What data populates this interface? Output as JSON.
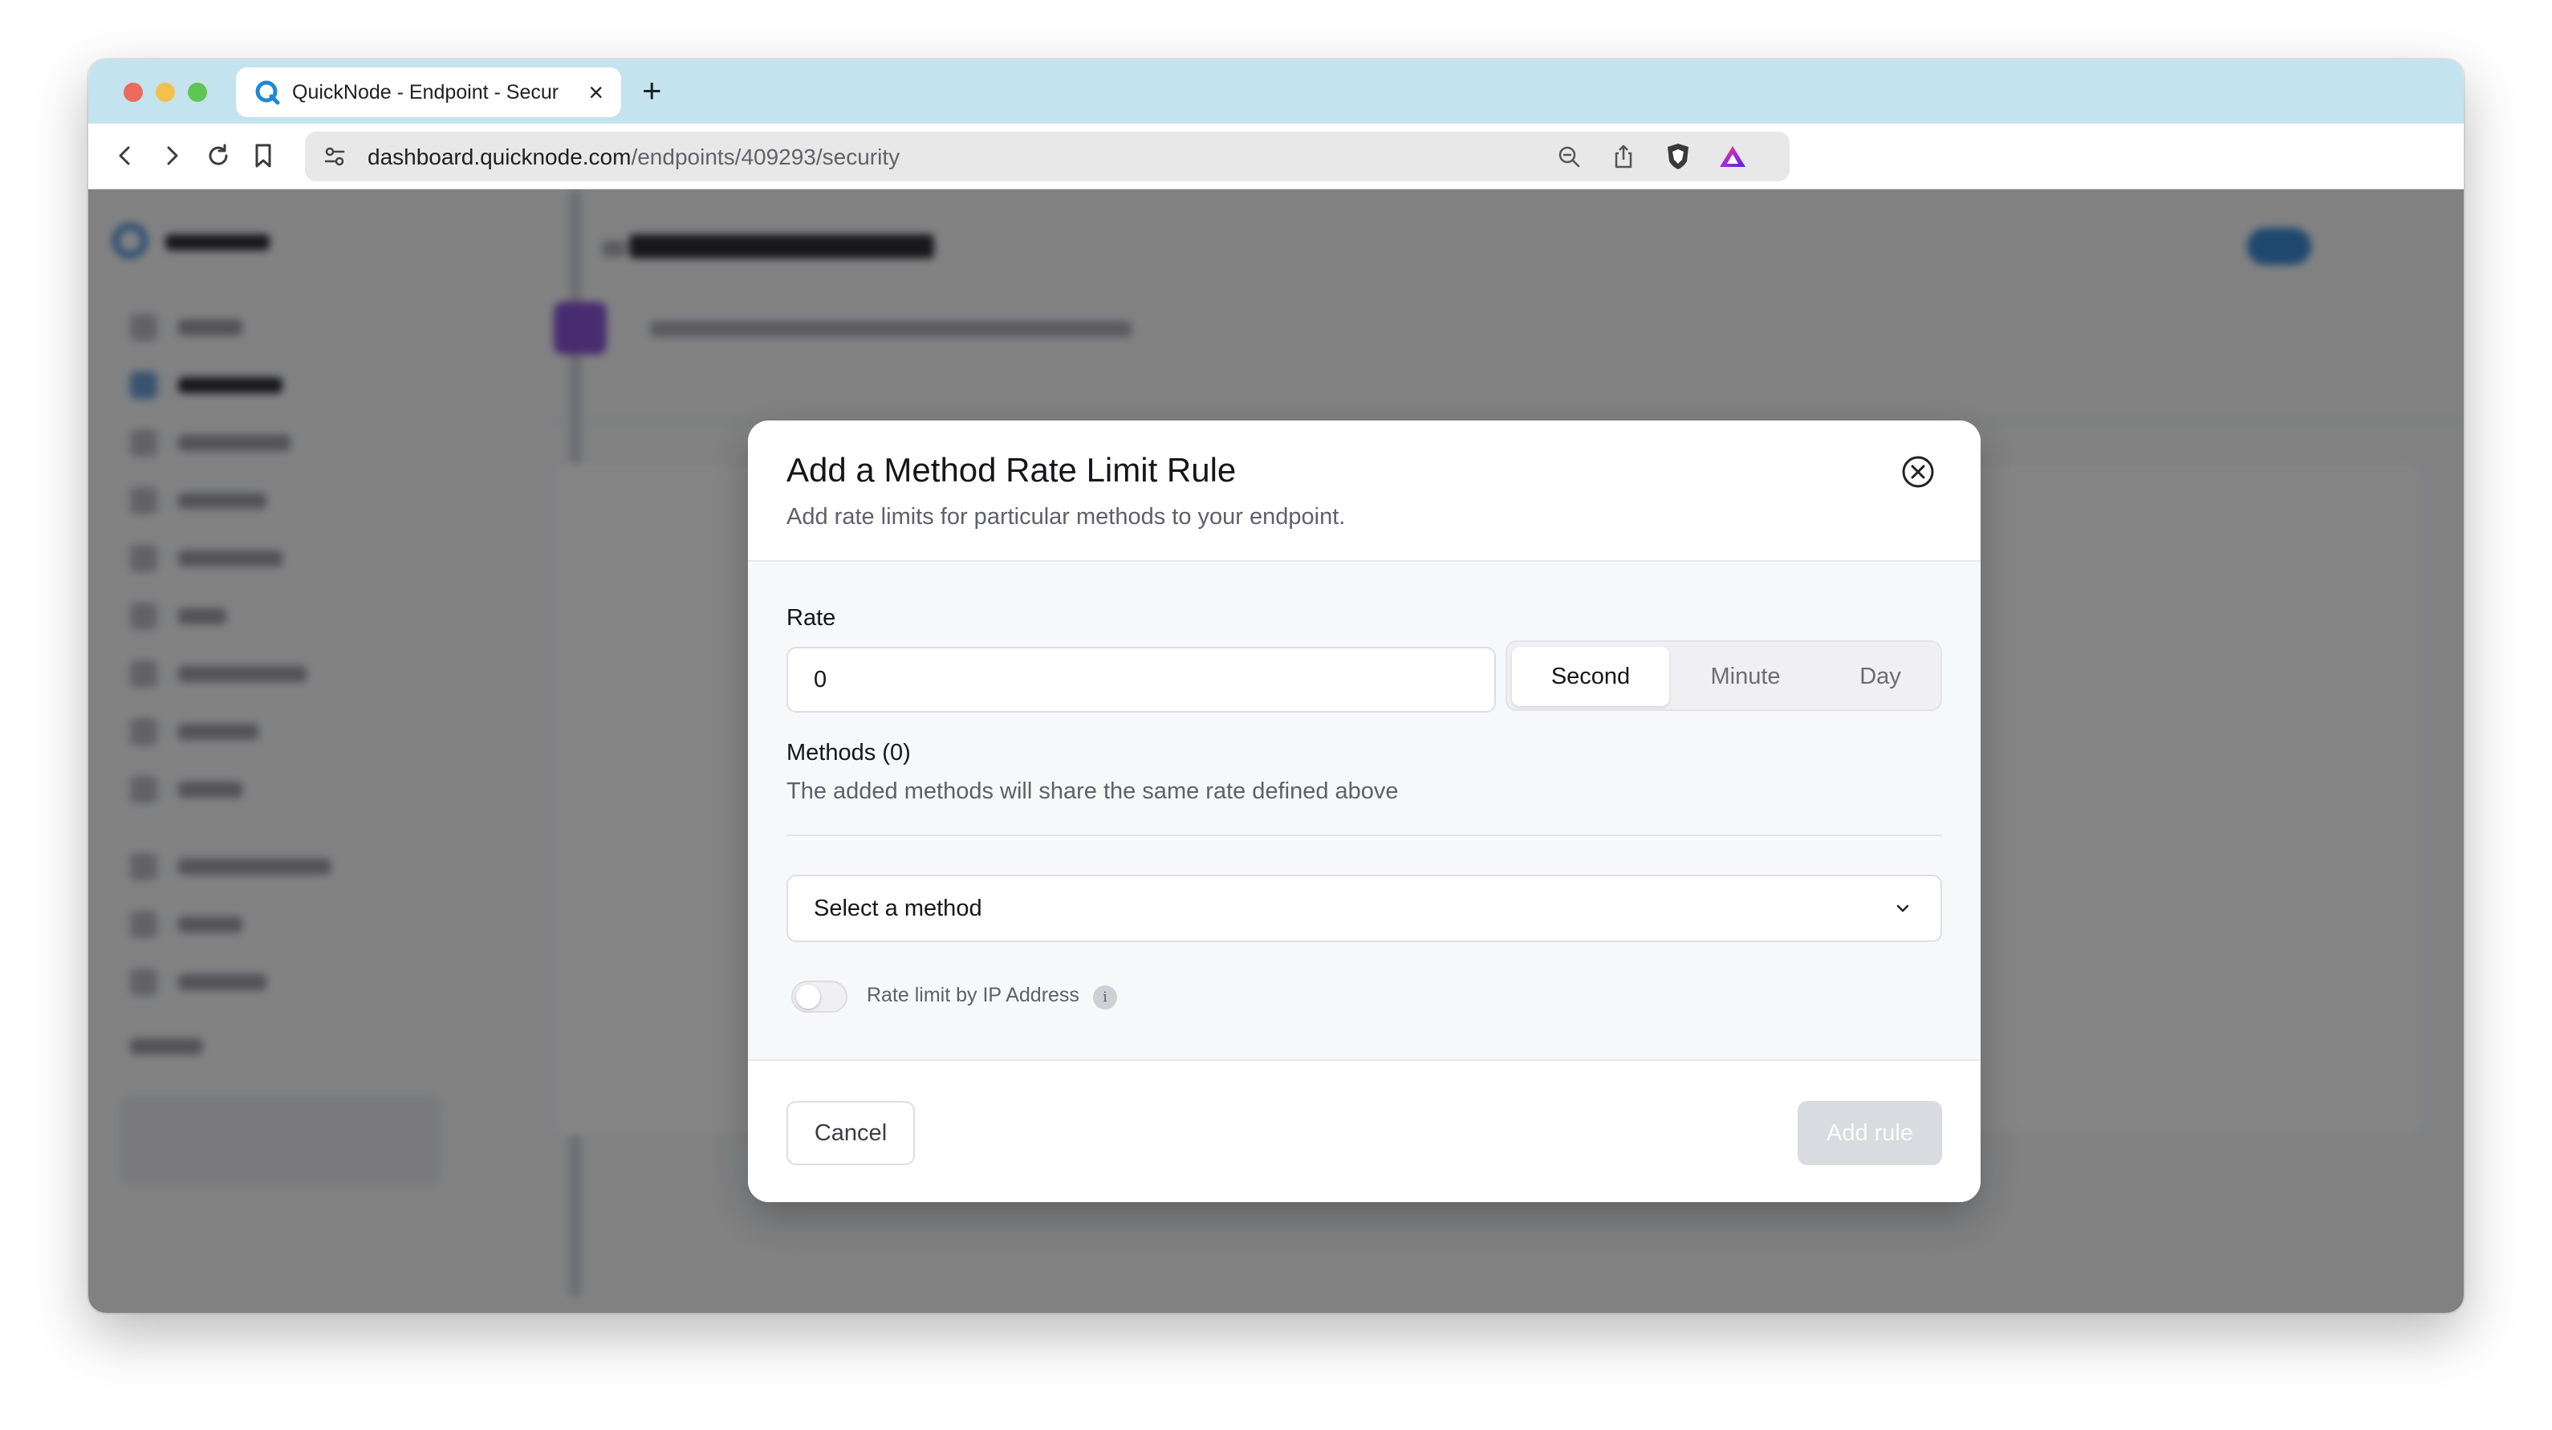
{
  "browser": {
    "tab_title": "QuickNode - Endpoint - Secur",
    "url_host": "dashboard.quicknode.com",
    "url_path": "/endpoints/409293/security"
  },
  "modal": {
    "title": "Add a Method Rate Limit Rule",
    "subtitle": "Add rate limits for particular methods to your endpoint.",
    "rate_label": "Rate",
    "rate_value": "0",
    "intervals": [
      "Second",
      "Minute",
      "Day"
    ],
    "selected_interval": "Second",
    "methods_label": "Methods (0)",
    "methods_description": "The added methods will share the same rate defined above",
    "select_placeholder": "Select a method",
    "ip_toggle_label": "Rate limit by IP Address",
    "ip_toggle_on": false,
    "cancel_label": "Cancel",
    "add_rule_label": "Add rule"
  },
  "colors": {
    "tabbar": "#c3e3ee",
    "disabled_button": "#d9dbe0",
    "overlay": "rgba(0,0,0,0.48)"
  }
}
